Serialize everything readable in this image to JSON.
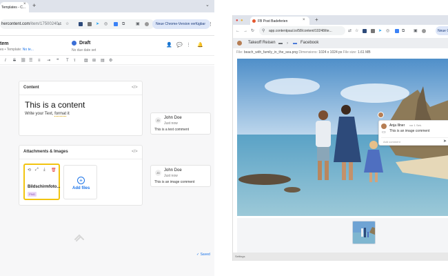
{
  "left_browser": {
    "tab_title": "Templates - C...",
    "url_host": "hercontent.com",
    "url_path": "/item/17500240...",
    "update_button": "Neue Chrome-Version verfügbar"
  },
  "app": {
    "title": "tem",
    "subtitle_prefix": "es • Template: ",
    "subtitle_link": "No te...",
    "status": "Draft",
    "due_date": "No due date set"
  },
  "content_card": {
    "title": "Content",
    "code_icon_label": "</>",
    "heading": "This is a content",
    "paragraph_before": "Write your Text, ",
    "paragraph_underlined": "format",
    "paragraph_after": " it"
  },
  "attachments_card": {
    "title": "Attachments & Images",
    "code_icon_label": "</>",
    "file_name": "Bildschirmfoto...",
    "file_badge": "PNG",
    "add_files_label": "Add files"
  },
  "comments": [
    {
      "initials": "JD",
      "author": "John Doe",
      "time": "Just now",
      "text": "This is a text comment"
    },
    {
      "initials": "JD",
      "author": "John Doe",
      "time": "Just now",
      "text": "This is an image comment"
    }
  ],
  "saved_status": "Saved",
  "right_browser": {
    "tab_title": "FB Post Badeferien",
    "url": "app.contentpaul.io/58/content/10248/ite...",
    "update_button": "Neue C",
    "breadcrumb": [
      "Takeoff Reisen",
      "Facebook"
    ],
    "file_label": "File:",
    "file_name": "beach_with_family_in_the_sea.png",
    "dimensions_label": "Dimensions:",
    "dimensions": "1024 x 1024 px",
    "size_label": "File size:",
    "size": "1.61 MB",
    "footer": "Settings"
  },
  "image_comment": {
    "author": "Anja Illner",
    "time": "vor 1 Sek.",
    "text": "This is an image comment",
    "input_placeholder": "Add comment"
  },
  "colors": {
    "accent": "#1a73e8",
    "highlight_border": "#f2c40f",
    "draft_dot": "#3b6fd6"
  }
}
